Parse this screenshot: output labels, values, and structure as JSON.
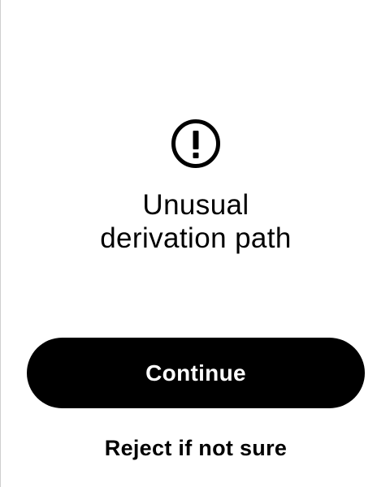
{
  "screen": {
    "icon": "exclamation-circle-icon",
    "title": "Unusual\nderivation path",
    "title_line1": "Unusual",
    "title_line2": "derivation path"
  },
  "actions": {
    "continue_label": "Continue",
    "reject_label": "Reject if not sure"
  },
  "colors": {
    "background": "#ffffff",
    "primary": "#000000",
    "primary_text": "#ffffff"
  }
}
